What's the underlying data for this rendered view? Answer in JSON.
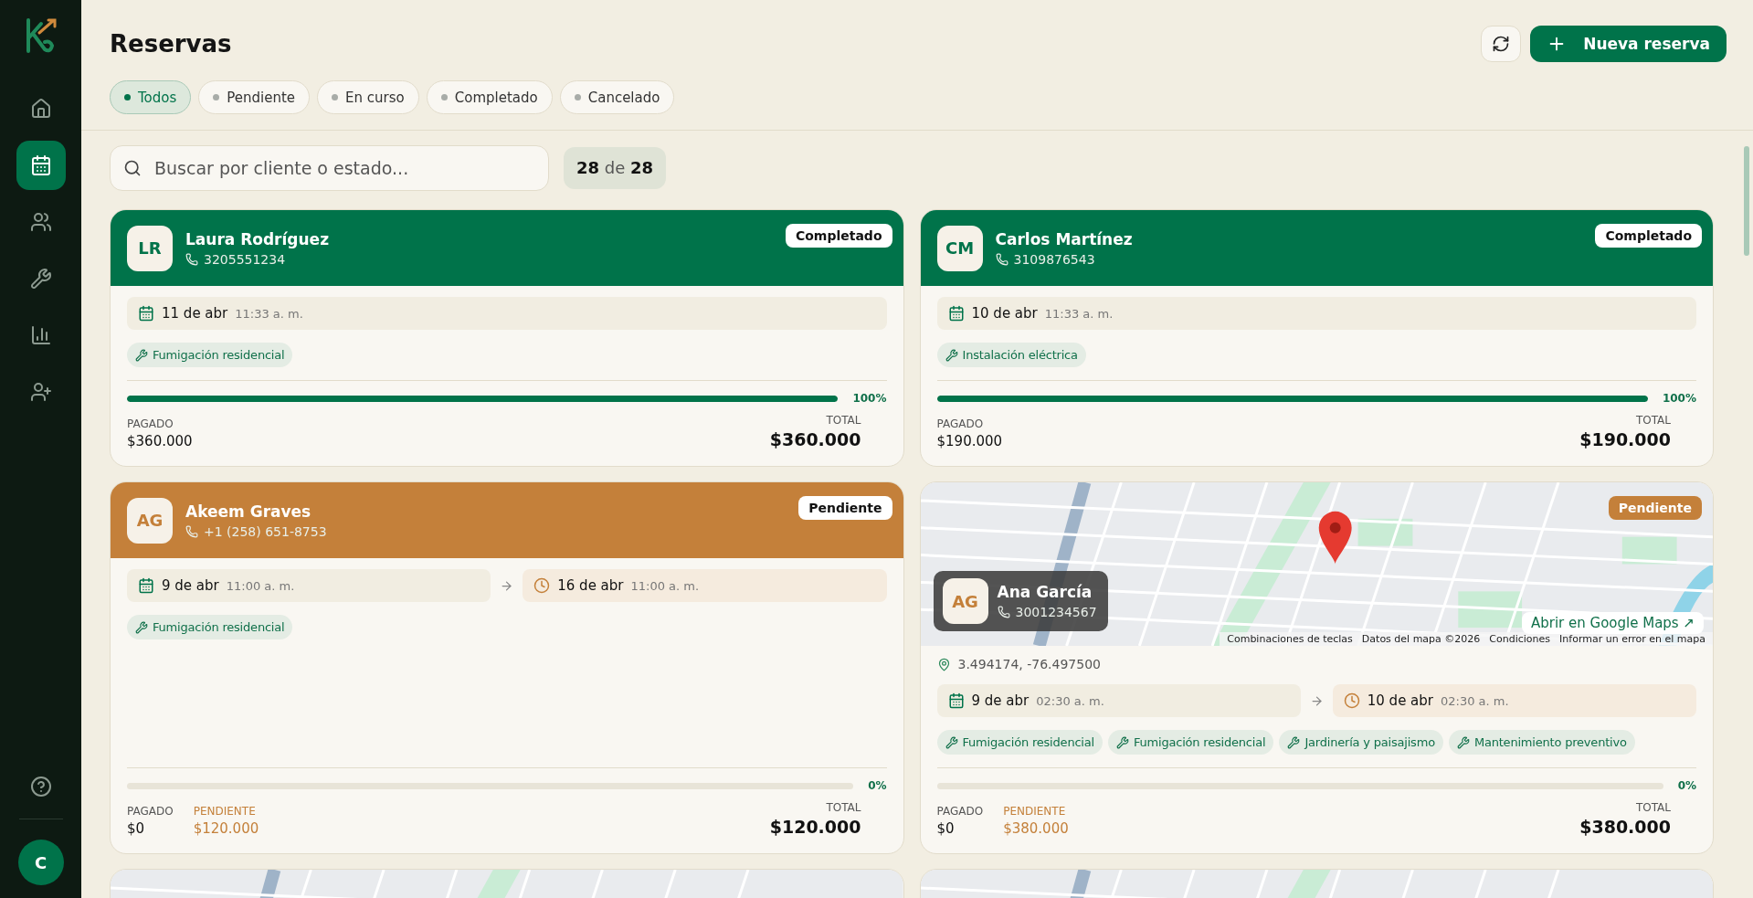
{
  "sidebar": {
    "items": [
      {
        "selected": false
      },
      {
        "selected": true
      },
      {
        "selected": false
      },
      {
        "selected": false
      },
      {
        "selected": false
      },
      {
        "selected": false
      }
    ],
    "user_initial": "C"
  },
  "header": {
    "title": "Reservas",
    "new_button": "Nueva reserva"
  },
  "filters": [
    {
      "label": "Todos",
      "selected": true
    },
    {
      "label": "Pendiente",
      "selected": false
    },
    {
      "label": "En curso",
      "selected": false
    },
    {
      "label": "Completado",
      "selected": false
    },
    {
      "label": "Cancelado",
      "selected": false
    }
  ],
  "search": {
    "placeholder": "Buscar por cliente o estado...",
    "count": "**28** de **28**"
  },
  "cards": [
    {
      "kind": "header",
      "color": "#00734a",
      "status": "Completado",
      "initials": "LR",
      "name": "Laura Rodríguez",
      "phone": "3205551234",
      "start": {
        "date": "11 de abr",
        "time": "11:33 a. m."
      },
      "services": [
        "Fumigación residencial"
      ],
      "level": 1,
      "percent": "100%",
      "paid": {
        "label": "PAGADO",
        "value": "$360.000"
      },
      "total": {
        "label": "TOTAL",
        "value": "$360.000"
      }
    },
    {
      "kind": "header",
      "color": "#00734a",
      "status": "Completado",
      "initials": "CM",
      "name": "Carlos Martínez",
      "phone": "3109876543",
      "start": {
        "date": "10 de abr",
        "time": "11:33 a. m."
      },
      "services": [
        "Instalación eléctrica"
      ],
      "level": 1,
      "percent": "100%",
      "paid": {
        "label": "PAGADO",
        "value": "$190.000"
      },
      "total": {
        "label": "TOTAL",
        "value": "$190.000"
      }
    },
    {
      "kind": "header",
      "color": "#c4803a",
      "status": "Pendiente",
      "initials": "AG",
      "name": "Akeem Graves",
      "phone": "+1 (258) 651-8753",
      "start": {
        "date": "9 de abr",
        "time": "11:00 a. m."
      },
      "end": {
        "date": "16 de abr",
        "time": "11:00 a. m."
      },
      "services": [
        "Fumigación residencial"
      ],
      "level": 0,
      "percent": "0%",
      "paid": {
        "label": "PAGADO",
        "value": "$0"
      },
      "pending": {
        "label": "PENDIENTE",
        "value": "$120.000"
      },
      "total": {
        "label": "TOTAL",
        "value": "$120.000"
      }
    },
    {
      "kind": "map",
      "color": "#c4803a",
      "status": "Pendiente",
      "initials": "AG",
      "name": "Ana García",
      "phone": "3001234567",
      "maps_link": "Abrir en Google Maps ↗",
      "attribution": [
        "Combinaciones de teclas",
        "Datos del mapa ©2026",
        "Condiciones",
        "Informar un error en el mapa"
      ],
      "coords": "3.494174, -76.497500",
      "start": {
        "date": "9 de abr",
        "time": "02:30 a. m."
      },
      "end": {
        "date": "10 de abr",
        "time": "02:30 a. m."
      },
      "services": [
        "Fumigación residencial",
        "Fumigación residencial",
        "Jardinería y paisajismo",
        "Mantenimiento preventivo"
      ],
      "level": 0,
      "percent": "0%",
      "paid": {
        "label": "PAGADO",
        "value": "$0"
      },
      "pending": {
        "label": "PENDIENTE",
        "value": "$380.000"
      },
      "total": {
        "label": "TOTAL",
        "value": "$380.000"
      }
    },
    {
      "kind": "map_partial"
    },
    {
      "kind": "map_partial"
    }
  ]
}
